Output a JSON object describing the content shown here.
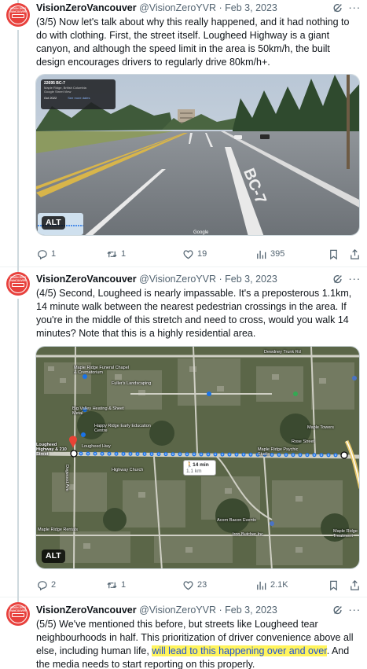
{
  "tweets": [
    {
      "avatar_text": "VISION ZERO VANCOUVER",
      "name": "VisionZeroVancouver",
      "handle": "@VisionZeroYVR",
      "separator": "·",
      "time": "Feb 3, 2023",
      "text": "(3/5) Now let's talk about why this really happened, and it had nothing to do with clothing. First, the street itself. Lougheed Highway is a giant canyon, and although the speed limit in the area is 50km/h, the built design encourages drivers to regularly drive 80km/h+.",
      "media": {
        "alt_label": "ALT",
        "overlay_title": "22695 BC-7",
        "overlay_sub": "Maple Ridge, British Columbia",
        "overlay_brand": "Google Street View",
        "overlay_date": "Oct 2022",
        "overlay_more": "See more dates",
        "road_marking": "BC-7",
        "watermark": "Google"
      },
      "stats": {
        "replies": "1",
        "reposts": "1",
        "likes": "19",
        "views": "395"
      }
    },
    {
      "avatar_text": "VISION ZERO VANCOUVER",
      "name": "VisionZeroVancouver",
      "handle": "@VisionZeroYVR",
      "separator": "·",
      "time": "Feb 3, 2023",
      "text": "(4/5) Second, Lougheed is nearly impassable. It's a preposterous 1.1km, 14 minute walk between the nearest pedestrian crossings in the area. If you're in the middle of this stretch and need to cross, would you walk 14 minutes? Note that this is a highly residential area.",
      "media": {
        "alt_label": "ALT",
        "walk_time": "14 min",
        "walk_dist": "1.1 km",
        "labels": [
          "Maple Ridge Funeral Chapel & Crematorium",
          "Fuller's Landscaping",
          "Big Valley Heating & Sheet Metal",
          "Happy Ridge Early Education Centre",
          "Highway Church",
          "Maple Ridge Psychic Studio",
          "Maple Towers",
          "Rose Street",
          "Acorn Bacon Events",
          "Iron Butcher Inc",
          "Dewdney Trunk Rd",
          "Lougheed Highway & 210 Street",
          "Lougheed Hwy",
          "Dogwood Ave",
          "Maple Ridge Rentals",
          "Maple Ridge Treatment"
        ]
      },
      "stats": {
        "replies": "2",
        "reposts": "1",
        "likes": "23",
        "views": "2.1K"
      }
    },
    {
      "avatar_text": "VISION ZERO VANCOUVER",
      "name": "VisionZeroVancouver",
      "handle": "@VisionZeroYVR",
      "separator": "·",
      "time": "Feb 3, 2023",
      "text_before": "(5/5) We've mentioned this before, but streets like Lougheed tear neighbourhoods in half. This prioritization of driver convenience above all else, including human life, ",
      "text_highlight": "will lead to this happening over and over",
      "text_after": ". And the media needs to start reporting on this properly."
    }
  ],
  "colors": {
    "accent": "#1d9bf0",
    "text": "#0f1419",
    "muted": "#536471",
    "highlight": "#fff45c",
    "avatar": "#e8413d"
  }
}
